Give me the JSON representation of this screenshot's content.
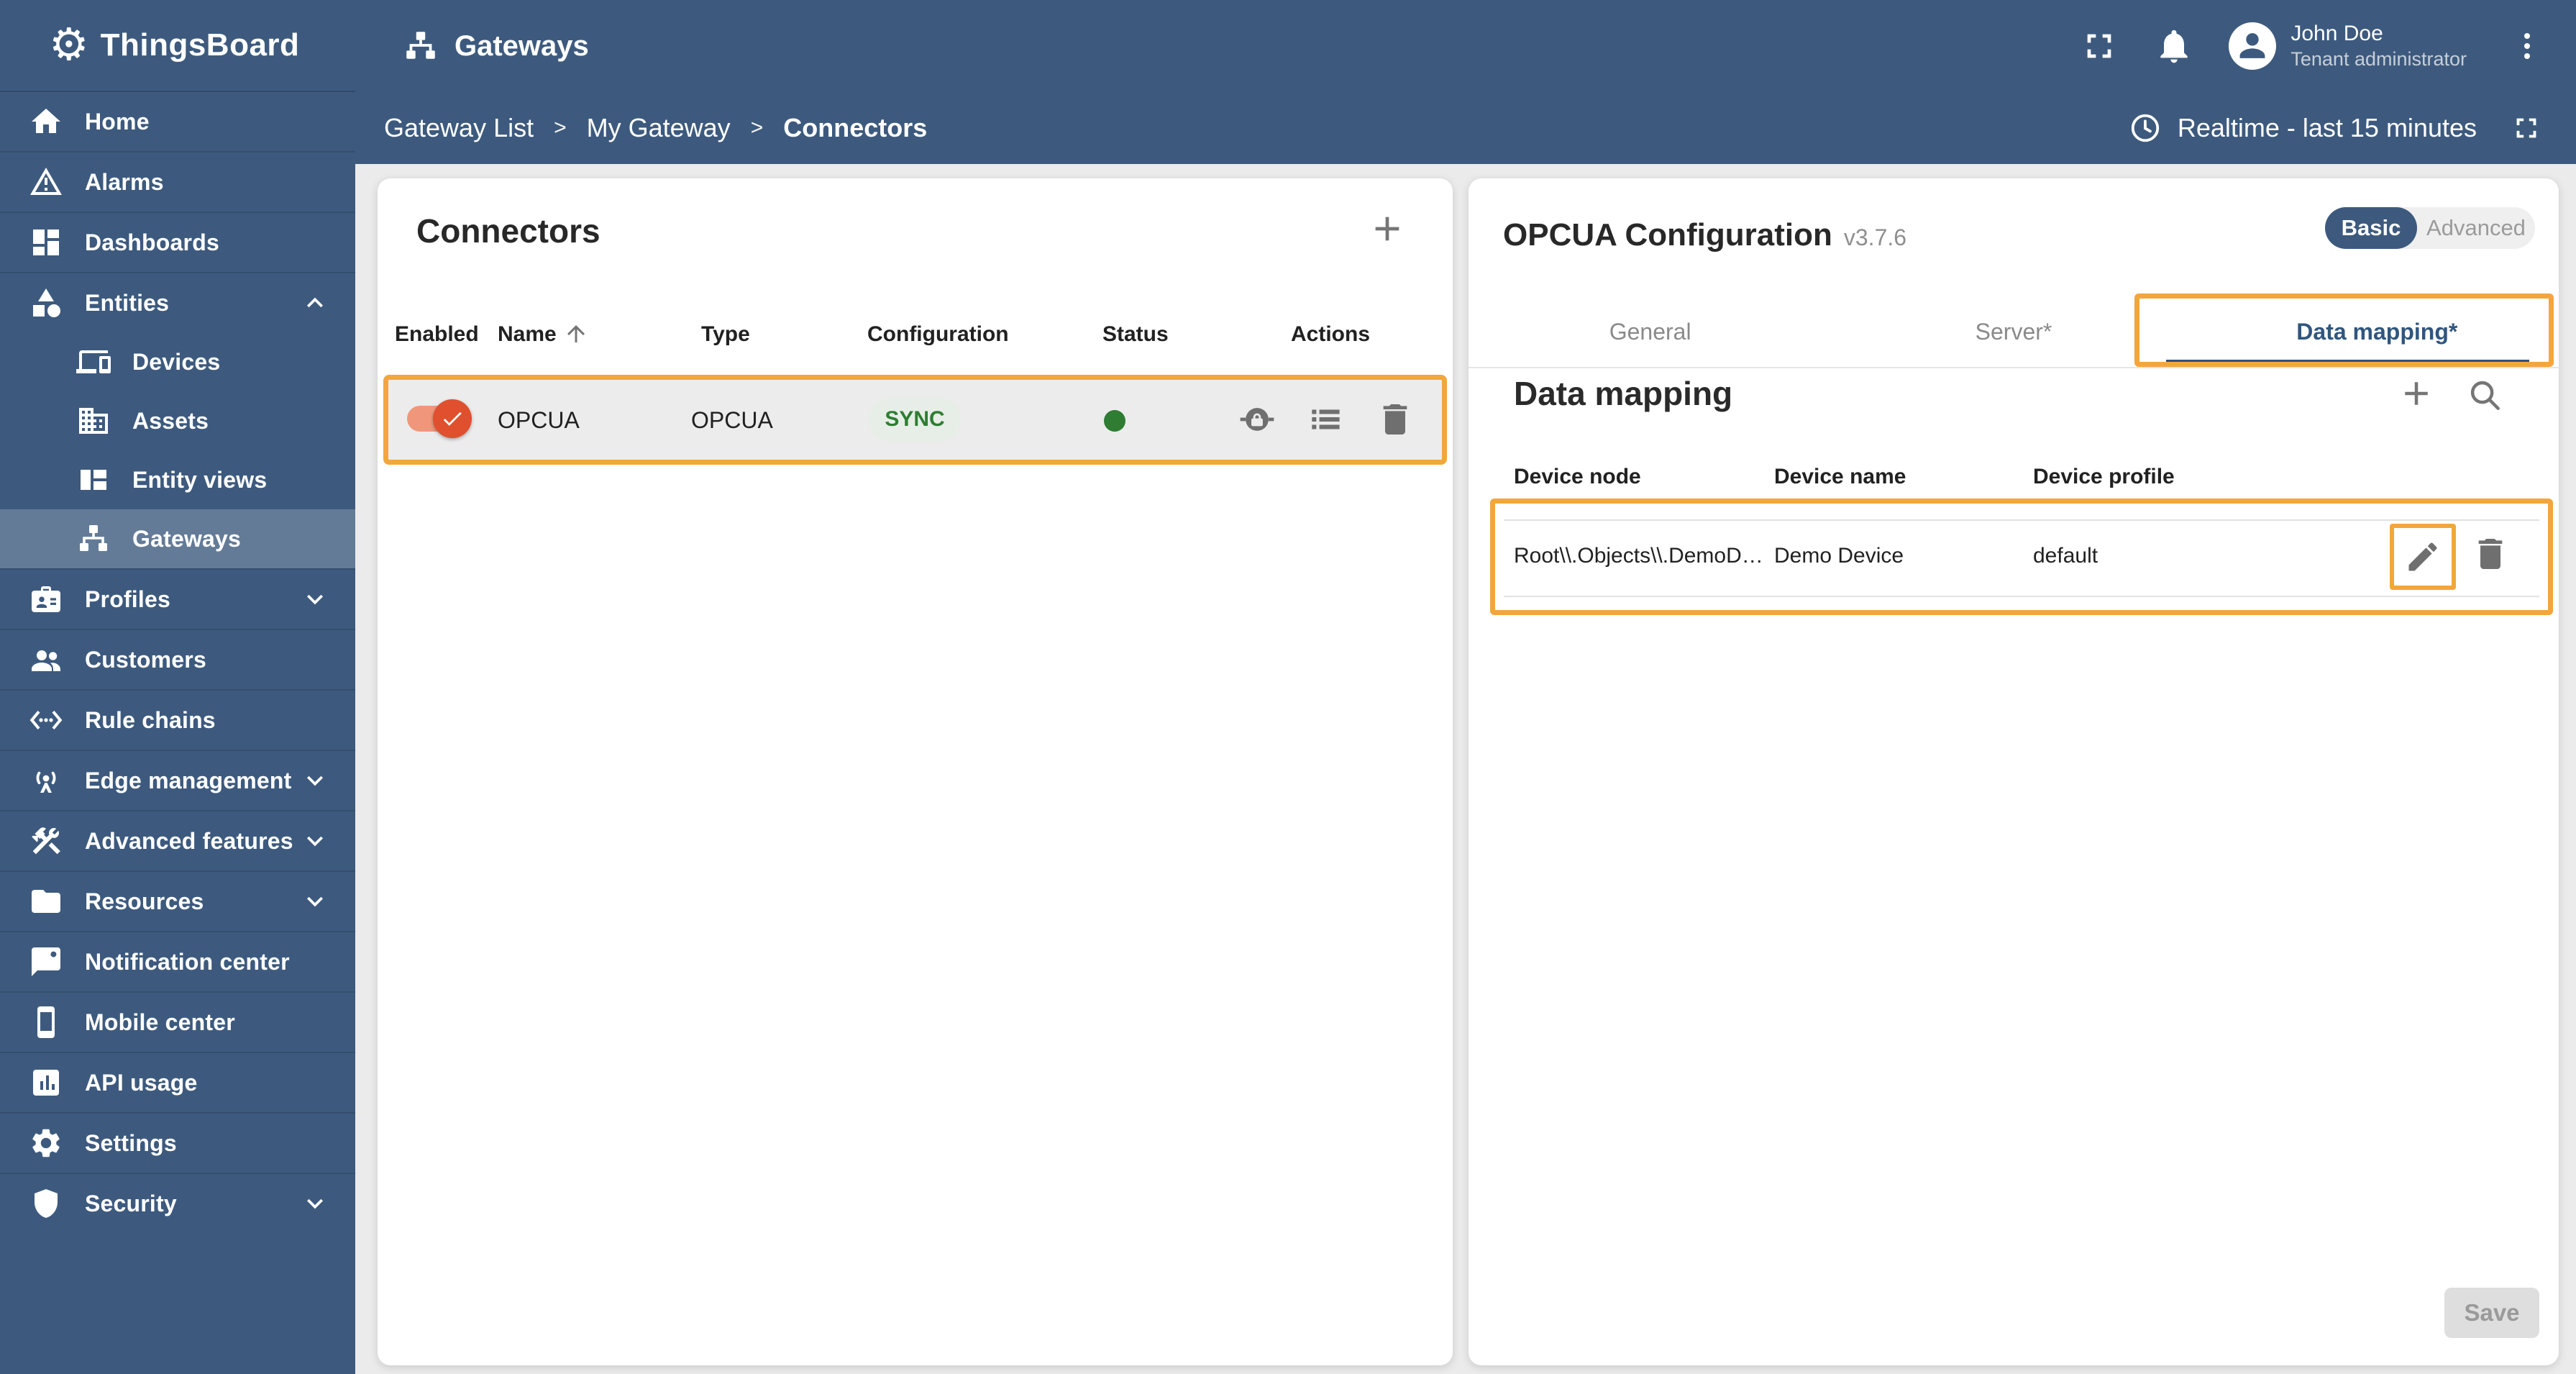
{
  "app_title": "ThingsBoard",
  "annotation_color": "#F2A63C",
  "topbar": {
    "page_title": "Gateways",
    "user": {
      "name": "John Doe",
      "role": "Tenant administrator"
    }
  },
  "breadcrumb": {
    "items": [
      "Gateway List",
      "My Gateway",
      "Connectors"
    ],
    "separator": ">"
  },
  "timewindow": {
    "label": "Realtime - last 15 minutes"
  },
  "sidebar": {
    "items": [
      {
        "label": "Home",
        "icon": "home"
      },
      {
        "label": "Alarms",
        "icon": "warning"
      },
      {
        "label": "Dashboards",
        "icon": "dashboards"
      },
      {
        "label": "Entities",
        "icon": "category",
        "expandable": true,
        "expanded": true
      },
      {
        "label": "Devices",
        "icon": "devices",
        "child": true
      },
      {
        "label": "Assets",
        "icon": "domain",
        "child": true
      },
      {
        "label": "Entity views",
        "icon": "view-quilt",
        "child": true
      },
      {
        "label": "Gateways",
        "icon": "lan",
        "child": true,
        "selected": true
      },
      {
        "label": "Profiles",
        "icon": "badge",
        "expandable": true,
        "expanded": false
      },
      {
        "label": "Customers",
        "icon": "people"
      },
      {
        "label": "Rule chains",
        "icon": "settings-ethernet"
      },
      {
        "label": "Edge management",
        "icon": "wifi-tethering",
        "expandable": true,
        "expanded": false
      },
      {
        "label": "Advanced features",
        "icon": "construction",
        "expandable": true,
        "expanded": false
      },
      {
        "label": "Resources",
        "icon": "folder",
        "expandable": true,
        "expanded": false
      },
      {
        "label": "Notification center",
        "icon": "notification"
      },
      {
        "label": "Mobile center",
        "icon": "smartphone"
      },
      {
        "label": "API usage",
        "icon": "insert-chart"
      },
      {
        "label": "Settings",
        "icon": "gear"
      },
      {
        "label": "Security",
        "icon": "shield",
        "expandable": true,
        "expanded": false
      }
    ]
  },
  "connectors_panel": {
    "title": "Connectors",
    "columns": [
      "Enabled",
      "Name",
      "Type",
      "Configuration",
      "Status",
      "Actions"
    ],
    "sort_column": "Name",
    "rows": [
      {
        "enabled": true,
        "name": "OPCUA",
        "type": "OPCUA",
        "configuration": "SYNC",
        "configuration_color": "#2E7D32",
        "status_color": "#2E7D32"
      }
    ]
  },
  "config_panel": {
    "title": "OPCUA Configuration",
    "version": "v3.7.6",
    "mode_toggle": {
      "options": [
        "Basic",
        "Advanced"
      ],
      "selected": "Basic"
    },
    "tabs": [
      {
        "label": "General"
      },
      {
        "label": "Server*"
      },
      {
        "label": "Data mapping*",
        "selected": true
      }
    ],
    "section": {
      "title": "Data mapping",
      "columns": [
        "Device node",
        "Device name",
        "Device profile"
      ],
      "rows": [
        {
          "device_node": "Root\\\\.Objects\\\\.DemoD…",
          "device_name": "Demo Device",
          "device_profile": "default"
        }
      ]
    },
    "save_label": "Save",
    "save_disabled": true
  }
}
